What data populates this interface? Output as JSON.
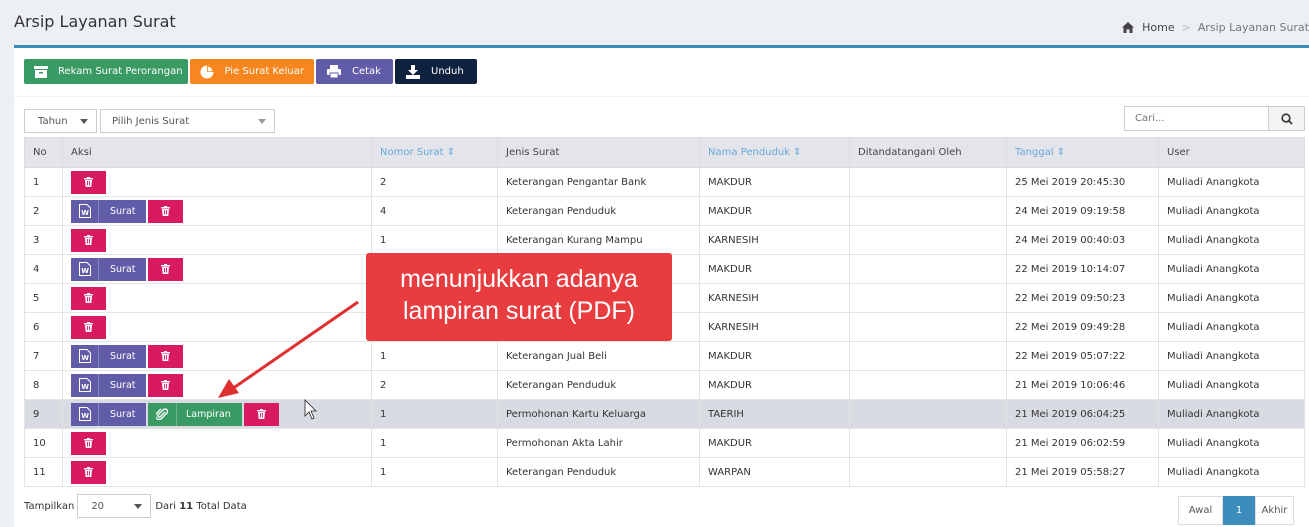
{
  "header": {
    "title": "Arsip Layanan Surat",
    "breadcrumb": {
      "home": "Home",
      "current": "Arsip Layanan Surat"
    }
  },
  "toolbar": {
    "rekam": "Rekam Surat Perorangan",
    "pie": "Pie Surat Keluar",
    "cetak": "Cetak",
    "unduh": "Unduh"
  },
  "filters": {
    "tahun": "Tahun",
    "jenis": "Pilih Jenis Surat",
    "search_placeholder": "Cari..."
  },
  "table": {
    "headers": [
      "No",
      "Aksi",
      "Nomor Surat",
      "Jenis Surat",
      "Nama Penduduk",
      "Ditandatangani Oleh",
      "Tanggal",
      "User"
    ],
    "surat_label": "Surat",
    "lampiran_label": "Lampiran",
    "rows": [
      {
        "no": "1",
        "nomor": "2",
        "jenis": "Keterangan Pengantar Bank",
        "nama": "MAKDUR",
        "ttd": "",
        "tanggal": "25 Mei 2019 20:45:30",
        "user": "Muliadi Anangkota"
      },
      {
        "no": "2",
        "nomor": "4",
        "jenis": "Keterangan Penduduk",
        "nama": "MAKDUR",
        "ttd": "",
        "tanggal": "24 Mei 2019 09:19:58",
        "user": "Muliadi Anangkota"
      },
      {
        "no": "3",
        "nomor": "1",
        "jenis": "Keterangan Kurang Mampu",
        "nama": "KARNESIH",
        "ttd": "",
        "tanggal": "24 Mei 2019 00:40:03",
        "user": "Muliadi Anangkota"
      },
      {
        "no": "4",
        "nomor": "",
        "jenis": "",
        "nama": "MAKDUR",
        "ttd": "",
        "tanggal": "22 Mei 2019 10:14:07",
        "user": "Muliadi Anangkota"
      },
      {
        "no": "5",
        "nomor": "",
        "jenis": "",
        "nama": "KARNESIH",
        "ttd": "",
        "tanggal": "22 Mei 2019 09:50:23",
        "user": "Muliadi Anangkota"
      },
      {
        "no": "6",
        "nomor": "",
        "jenis": "",
        "nama": "KARNESIH",
        "ttd": "",
        "tanggal": "22 Mei 2019 09:49:28",
        "user": "Muliadi Anangkota"
      },
      {
        "no": "7",
        "nomor": "1",
        "jenis": "Keterangan Jual Beli",
        "nama": "MAKDUR",
        "ttd": "",
        "tanggal": "22 Mei 2019 05:07:22",
        "user": "Muliadi Anangkota"
      },
      {
        "no": "8",
        "nomor": "2",
        "jenis": "Keterangan Penduduk",
        "nama": "MAKDUR",
        "ttd": "",
        "tanggal": "21 Mei 2019 10:06:46",
        "user": "Muliadi Anangkota"
      },
      {
        "no": "9",
        "nomor": "1",
        "jenis": "Permohonan Kartu Keluarga",
        "nama": "TAERIH",
        "ttd": "",
        "tanggal": "21 Mei 2019 06:04:25",
        "user": "Muliadi Anangkota"
      },
      {
        "no": "10",
        "nomor": "1",
        "jenis": "Permohonan Akta Lahir",
        "nama": "MAKDUR",
        "ttd": "",
        "tanggal": "21 Mei 2019 06:02:59",
        "user": "Muliadi Anangkota"
      },
      {
        "no": "11",
        "nomor": "1",
        "jenis": "Keterangan Penduduk",
        "nama": "WARPAN",
        "ttd": "",
        "tanggal": "21 Mei 2019 05:58:27",
        "user": "Muliadi Anangkota"
      }
    ]
  },
  "footer": {
    "tampilkan": "Tampilkan",
    "page_size": "20",
    "dari": "Dari",
    "total": "11",
    "total_suffix": "Total Data"
  },
  "pagination": {
    "first": "Awal",
    "current": "1",
    "last": "Akhir"
  },
  "annotation": {
    "line1": "menunjukkan adanya",
    "line2": "lampiran surat (PDF)"
  },
  "colors": {
    "accent": "#3c8dbc",
    "green": "#3a9a64",
    "orange": "#f7861f",
    "purple": "#605ca8",
    "navy": "#0e2240",
    "pink": "#d81b60",
    "callout": "#e83c3f"
  }
}
